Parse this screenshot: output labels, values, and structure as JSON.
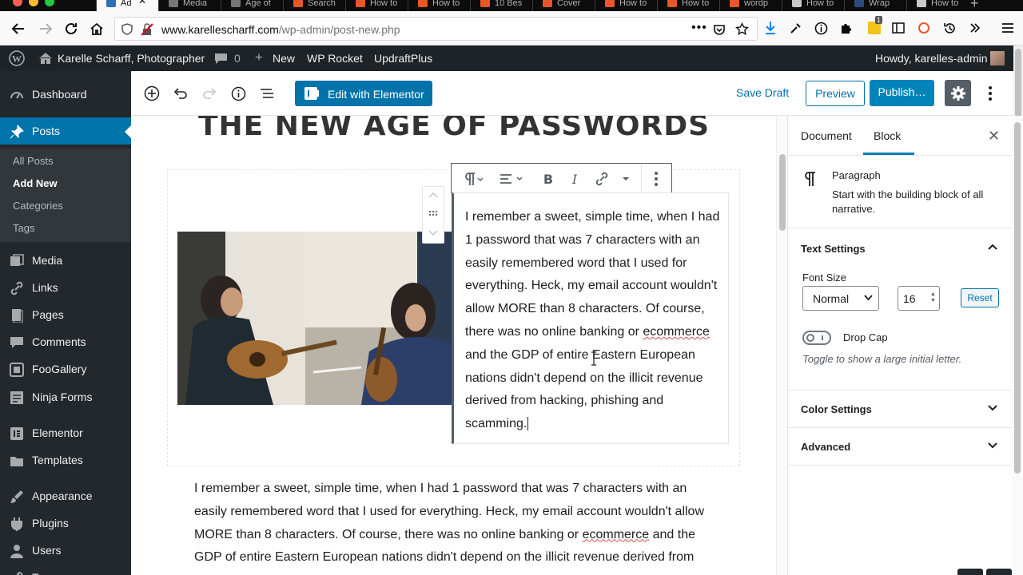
{
  "browser": {
    "tabs": [
      {
        "label": "Ad",
        "color": "#2c70b8",
        "active": true
      },
      {
        "label": "Media",
        "color": "#777777"
      },
      {
        "label": "Age of",
        "color": "#777777"
      },
      {
        "label": "Search",
        "color": "#e8572a"
      },
      {
        "label": "How to",
        "color": "#e8572a"
      },
      {
        "label": "How to",
        "color": "#e8572a"
      },
      {
        "label": "10 Bes",
        "color": "#e8572a"
      },
      {
        "label": "Cover",
        "color": "#e8572a"
      },
      {
        "label": "How to",
        "color": "#e8572a"
      },
      {
        "label": "How to",
        "color": "#e8572a"
      },
      {
        "label": "wordp",
        "color": "#e8572a"
      },
      {
        "label": "How to",
        "color": "#c9c9c9"
      },
      {
        "label": "Wrap",
        "color": "#2a4b7c"
      },
      {
        "label": "How to",
        "color": "#c9c9c9"
      }
    ],
    "url_domain": "www.karellescharff.com",
    "url_path": "/wp-admin/post-new.php",
    "url_prefix": "",
    "notification_count": "1"
  },
  "adminbar": {
    "site_name": "Karelle Scharff, Photographer",
    "comments_count": "0",
    "new_label": "New",
    "wp_rocket": "WP Rocket",
    "updraft": "UpdraftPlus",
    "howdy": "Howdy, karelles-admin"
  },
  "sidebar": {
    "items": [
      {
        "label": "Dashboard",
        "icon": "dashboard-icon"
      },
      {
        "label": "Posts",
        "icon": "pin-icon",
        "current": true
      },
      {
        "label": "Media",
        "icon": "media-icon"
      },
      {
        "label": "Links",
        "icon": "link-icon"
      },
      {
        "label": "Pages",
        "icon": "pages-icon"
      },
      {
        "label": "Comments",
        "icon": "comment-icon"
      },
      {
        "label": "FooGallery",
        "icon": "gallery-icon"
      },
      {
        "label": "Ninja Forms",
        "icon": "forms-icon"
      },
      {
        "label": "Elementor",
        "icon": "elementor-icon"
      },
      {
        "label": "Templates",
        "icon": "folder-icon"
      },
      {
        "label": "Appearance",
        "icon": "brush-icon"
      },
      {
        "label": "Plugins",
        "icon": "plugin-icon"
      },
      {
        "label": "Users",
        "icon": "user-icon"
      },
      {
        "label": "To",
        "icon": "tools-icon"
      }
    ],
    "submenu": [
      "All Posts",
      "Add New",
      "Categories",
      "Tags"
    ],
    "submenu_current": "Add New"
  },
  "editor": {
    "edit_with_elementor": "Edit with Elementor",
    "save_draft": "Save Draft",
    "preview": "Preview",
    "publish": "Publish…",
    "post_title": "THE NEW AGE OF PASSWORDS",
    "para_before": "I remember a sweet, simple time, when I had 1 password that was 7 characters with an easily remembered word that I used for everything. Heck, my email account wouldn't allow MORE than 8 characters. Of course, there was no online banking or ",
    "para_misspelled": "ecommerce",
    "para_after": " and the GDP of entire Eastern European nations didn't depend on the illicit revenue derived from hacking, phishing and scamming.",
    "below_before": "I remember a sweet, simple time, when I had 1 password that was 7 characters with an easily remembered word that I used for everything. Heck, my email account wouldn't allow MORE than 8 characters. Of course, there was no online banking or ",
    "below_misspelled": "ecommerce",
    "below_after": " and the GDP of entire Eastern European nations didn't depend on the illicit revenue derived from"
  },
  "settings": {
    "tab_document": "Document",
    "tab_block": "Block",
    "active_tab": "Block",
    "block_name": "Paragraph",
    "block_description": "Start with the building block of all narrative.",
    "text_settings": "Text Settings",
    "font_size_label": "Font Size",
    "font_size_select": "Normal",
    "font_size_value": "16",
    "reset": "Reset",
    "drop_cap_label": "Drop Cap",
    "drop_cap_help": "Toggle to show a large initial letter.",
    "drop_cap_enabled": false,
    "color_settings": "Color Settings",
    "advanced": "Advanced"
  },
  "colors": {
    "wp_blue": "#0073aa",
    "admin_dark": "#23282d",
    "adminbar": "#1d2327"
  }
}
